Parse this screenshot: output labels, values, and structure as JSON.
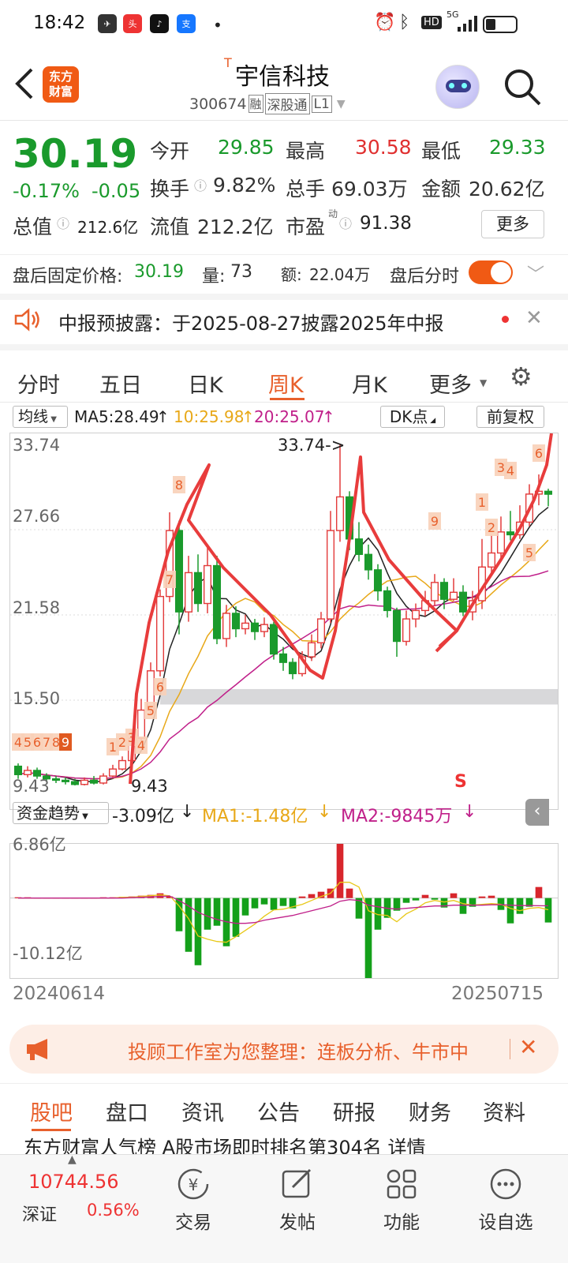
{
  "status_bar": {
    "time": "18:42",
    "hd": "HD",
    "net": "5G"
  },
  "header": {
    "logo_line1": "东方",
    "logo_line2": "财富",
    "title_prefix": "T",
    "title": "宇信科技",
    "code": "300674",
    "tag_rong": "融",
    "tag_shen": "深股通",
    "tag_level": "L1"
  },
  "quote": {
    "price": "30.19",
    "change_pct": "-0.17%",
    "change": "-0.05",
    "open_label": "今开",
    "open": "29.85",
    "high_label": "最高",
    "high": "30.58",
    "low_label": "最低",
    "low": "29.33",
    "turnover_label": "换手",
    "turnover": "9.82%",
    "volume_label": "总手",
    "volume": "69.03万",
    "amount_label": "金额",
    "amount": "20.62亿",
    "mcap_label": "总值",
    "mcap": "212.6亿",
    "float_label": "流值",
    "float": "212.2亿",
    "pe_label": "市盈",
    "pe_sup": "动",
    "pe": "91.38",
    "more": "更多"
  },
  "after_hours": {
    "price_label": "盘后固定价格:",
    "price": "30.19",
    "vol_label": "量:",
    "vol": "73",
    "amt_label": "额:",
    "amt": "22.04万",
    "toggle_label": "盘后分时"
  },
  "notice": {
    "text": "中报预披露：于2025-08-27披露2025年中报"
  },
  "tabs": [
    "分时",
    "五日",
    "日K",
    "周K",
    "月K",
    "更多"
  ],
  "indicator_bar": {
    "ind": "均线",
    "ma5": "MA5:28.49",
    "ma10": "10:25.98",
    "ma20": "20:25.07",
    "dk": "DK点",
    "adjust": "前复权"
  },
  "chart_data": {
    "type": "candlestick",
    "ylim": [
      9.43,
      33.74
    ],
    "y_ticks": [
      "33.74",
      "27.66",
      "21.58",
      "15.50",
      "9.43"
    ],
    "high_label": "33.74->",
    "low_label": "9.43",
    "signal_label": "S",
    "markers": [
      "4",
      "5",
      "6",
      "7",
      "8",
      "9",
      "1",
      "2",
      "3",
      "4",
      "5",
      "6",
      "7",
      "8",
      "9",
      "1",
      "2",
      "3",
      "4",
      "5",
      "6"
    ],
    "weeks": [
      [
        10.8,
        10.2,
        11.0,
        9.9
      ],
      [
        10.2,
        10.5,
        10.8,
        10.0
      ],
      [
        10.5,
        10.1,
        10.7,
        9.9
      ],
      [
        10.1,
        9.9,
        10.3,
        9.7
      ],
      [
        9.9,
        9.8,
        10.1,
        9.6
      ],
      [
        9.8,
        9.7,
        10.0,
        9.5
      ],
      [
        9.7,
        9.5,
        9.9,
        9.43
      ],
      [
        9.5,
        9.8,
        10.0,
        9.43
      ],
      [
        9.8,
        9.6,
        10.1,
        9.5
      ],
      [
        9.6,
        10.1,
        10.3,
        9.5
      ],
      [
        10.1,
        10.6,
        10.9,
        10.0
      ],
      [
        10.6,
        11.2,
        11.5,
        10.5
      ],
      [
        11.2,
        12.8,
        13.1,
        11.0
      ],
      [
        12.8,
        14.8,
        15.6,
        12.6
      ],
      [
        14.8,
        17.6,
        18.2,
        14.5
      ],
      [
        17.6,
        22.9,
        23.4,
        17.2
      ],
      [
        22.9,
        27.6,
        28.9,
        22.5
      ],
      [
        27.6,
        21.8,
        28.3,
        20.2
      ],
      [
        21.8,
        24.6,
        25.8,
        21.1
      ],
      [
        24.6,
        22.4,
        25.9,
        21.8
      ],
      [
        22.4,
        25.1,
        26.4,
        21.7
      ],
      [
        25.1,
        19.9,
        25.8,
        19.5
      ],
      [
        19.9,
        21.7,
        22.3,
        19.3
      ],
      [
        21.7,
        20.6,
        22.2,
        20.0
      ],
      [
        20.6,
        21.0,
        21.6,
        20.2
      ],
      [
        21.0,
        20.4,
        21.3,
        19.8
      ],
      [
        20.4,
        20.9,
        21.4,
        20.0
      ],
      [
        20.9,
        18.8,
        21.1,
        18.4
      ],
      [
        18.8,
        18.2,
        19.3,
        17.6
      ],
      [
        18.2,
        17.4,
        18.5,
        17.0
      ],
      [
        17.4,
        18.6,
        19.0,
        17.2
      ],
      [
        18.6,
        19.6,
        20.2,
        18.3
      ],
      [
        19.6,
        21.3,
        21.8,
        19.2
      ],
      [
        21.3,
        27.6,
        29.0,
        21.0
      ],
      [
        27.6,
        30.0,
        33.74,
        26.8
      ],
      [
        30.0,
        27.0,
        30.4,
        26.2
      ],
      [
        27.0,
        25.9,
        28.2,
        25.4
      ],
      [
        25.9,
        24.8,
        26.6,
        24.1
      ],
      [
        24.8,
        23.3,
        25.2,
        22.6
      ],
      [
        23.3,
        21.9,
        23.6,
        21.4
      ],
      [
        21.9,
        19.7,
        22.1,
        18.6
      ],
      [
        19.7,
        21.3,
        21.9,
        19.4
      ],
      [
        21.3,
        21.9,
        22.4,
        20.7
      ],
      [
        21.9,
        22.6,
        23.3,
        21.5
      ],
      [
        22.6,
        23.9,
        24.5,
        22.2
      ],
      [
        23.9,
        22.7,
        24.2,
        22.0
      ],
      [
        22.7,
        23.2,
        24.2,
        22.6
      ],
      [
        23.2,
        21.8,
        23.7,
        21.5
      ],
      [
        21.8,
        22.6,
        23.3,
        21.2
      ],
      [
        22.6,
        25.0,
        27.0,
        22.0
      ],
      [
        25.0,
        26.0,
        27.3,
        24.6
      ],
      [
        26.0,
        27.5,
        28.6,
        25.4
      ],
      [
        27.5,
        27.3,
        29.0,
        26.9
      ],
      [
        27.3,
        28.2,
        29.4,
        27.0
      ],
      [
        28.2,
        30.2,
        30.9,
        27.9
      ],
      [
        30.2,
        30.4,
        31.6,
        29.4
      ],
      [
        30.4,
        30.19,
        30.58,
        29.33
      ]
    ]
  },
  "fund_flow": {
    "label": "资金趋势",
    "value": "-3.09亿",
    "ma1": "MA1:-1.48亿",
    "ma2": "MA2:-9845万",
    "ymax": "6.86亿",
    "ymin": "-10.12亿",
    "date_start": "20240614",
    "date_end": "20250715",
    "values": [
      0.1,
      0.1,
      0.05,
      0.05,
      0.05,
      0.05,
      0.05,
      0.05,
      0.05,
      0.1,
      0.1,
      0.15,
      0.2,
      0.3,
      0.4,
      0.6,
      0.2,
      -4.2,
      -6.8,
      -8.5,
      -4.0,
      -3.5,
      -6.1,
      -4.9,
      -2.2,
      -1.3,
      -0.8,
      -1.5,
      -1.0,
      -1.3,
      0.2,
      0.5,
      0.8,
      1.2,
      6.86,
      1.2,
      -2.6,
      -10.12,
      -4.0,
      -2.5,
      -1.6,
      -0.6,
      -0.3,
      0.4,
      -0.2,
      -1.2,
      0.6,
      -2.0,
      -1.1,
      0.2,
      0.3,
      -1.5,
      -3.2,
      -2.0,
      -1.1,
      1.4,
      -3.09
    ],
    "ma1_values": [
      0,
      0,
      0,
      0,
      0,
      0,
      0,
      0,
      0,
      0,
      0,
      0.1,
      0.1,
      0.2,
      0.3,
      0.4,
      0.3,
      -1.0,
      -2.6,
      -4.8,
      -5.2,
      -5.5,
      -5.6,
      -4.9,
      -4.1,
      -3.3,
      -2.3,
      -1.5,
      -1.4,
      -1.1,
      -0.8,
      -0.3,
      0.2,
      0.6,
      2.0,
      2.0,
      1.4,
      -1.6,
      -2.1,
      -2.2,
      -3.0,
      -2.0,
      -1.4,
      -0.6,
      -0.3,
      -0.5,
      -0.3,
      -0.7,
      -0.9,
      -0.8,
      -0.7,
      -0.8,
      -1.3,
      -1.6,
      -1.3,
      -1.2,
      -1.48
    ],
    "ma2_values": [
      0,
      0,
      0,
      0,
      0,
      0,
      0,
      0,
      0,
      0,
      0,
      0,
      0.05,
      0.1,
      0.15,
      0.2,
      0.25,
      -0.3,
      -1.0,
      -1.8,
      -2.3,
      -2.7,
      -3.0,
      -3.2,
      -3.2,
      -3.1,
      -2.8,
      -2.6,
      -2.4,
      -2.2,
      -1.9,
      -1.6,
      -1.3,
      -1.0,
      -0.4,
      -0.2,
      -0.3,
      -0.9,
      -1.1,
      -1.3,
      -1.4,
      -1.3,
      -1.2,
      -1.1,
      -1.0,
      -1.0,
      -0.9,
      -0.9,
      -0.9,
      -0.9,
      -0.85,
      -0.85,
      -0.9,
      -0.95,
      -0.95,
      -0.97,
      -0.98
    ]
  },
  "banner": {
    "text": "投顾工作室为您整理：连板分析、牛市中"
  },
  "bottom_tabs": [
    "股吧",
    "盘口",
    "资讯",
    "公告",
    "研报",
    "财务",
    "资料"
  ],
  "peek_text": "东方财富人气榜  A股市场即时排名第304名  详情",
  "bottom_nav": {
    "index_value": "10744.56",
    "index_name": "深证",
    "index_pct": "0.56%",
    "items": [
      "交易",
      "发帖",
      "功能",
      "设自选"
    ]
  }
}
